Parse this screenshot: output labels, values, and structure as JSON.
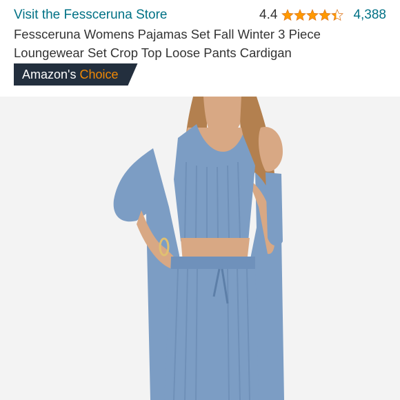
{
  "store": {
    "link_text": "Visit the Fessceruna Store"
  },
  "rating": {
    "value_text": "4.4",
    "value": 4.4,
    "max": 5,
    "review_count": "4,388",
    "star_color": "#ff9900"
  },
  "product": {
    "title": "Fessceruna Womens Pajamas Set Fall Winter 3 Piece Loungewear Set Crop Top Loose Pants Cardigan"
  },
  "badge": {
    "label": "Amazon's",
    "accent": "Choice",
    "background": "#232f3e",
    "accent_color": "#f08804"
  },
  "image": {
    "garment_color": "#7c9dc4",
    "background": "#f3f3f3"
  }
}
